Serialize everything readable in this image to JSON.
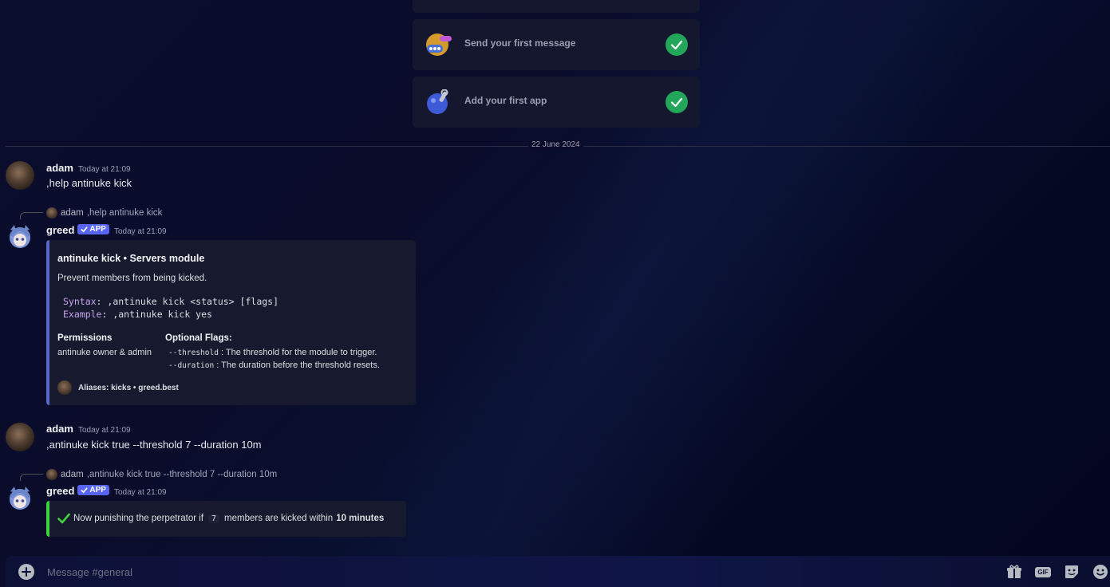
{
  "onboarding": {
    "cards": [
      {
        "label": "Send your first message",
        "icon": "chat-bubble-icon"
      },
      {
        "label": "Add your first app",
        "icon": "app-wrench-icon"
      }
    ]
  },
  "divider": {
    "date": "22 June 2024"
  },
  "messages": [
    {
      "author": "adam",
      "time": "Today at 21:09",
      "text": ",help antinuke kick"
    },
    {
      "reply": {
        "author": "adam",
        "text": ",help antinuke kick"
      },
      "author": "greed",
      "badge": "APP",
      "time": "Today at 21:09",
      "embed": {
        "title": "antinuke kick • Servers module",
        "description": "Prevent members from being kicked.",
        "syntax_key": "Syntax",
        "syntax_val": ": ,antinuke kick <status> [flags]",
        "example_key": "Example",
        "example_val": ": ,antinuke kick yes",
        "permissions_label": "Permissions",
        "permissions_value": "antinuke owner & admin",
        "flags_label": "Optional Flags:",
        "flag1_name": "--threshold",
        "flag1_desc": ": The threshold for the module to trigger.",
        "flag2_name": "--duration",
        "flag2_desc": ": The duration before the threshold resets.",
        "footer": "Aliases: kicks • greed.best"
      }
    },
    {
      "author": "adam",
      "time": "Today at 21:09",
      "text": ",antinuke kick true --threshold 7 --duration 10m"
    },
    {
      "reply": {
        "author": "adam",
        "text": ",antinuke kick true --threshold 7 --duration 10m"
      },
      "author": "greed",
      "badge": "APP",
      "time": "Today at 21:09",
      "success": {
        "prefix": "Now punishing the perpetrator if",
        "count": "7",
        "middle": "members are kicked within",
        "duration": "10 minutes"
      }
    }
  ],
  "composer": {
    "placeholder": "Message #general"
  },
  "colors": {
    "accent": "#5865f2",
    "success": "#23a55a",
    "embed_bar": "#5a67c9",
    "success_bar": "#3fd23f"
  }
}
